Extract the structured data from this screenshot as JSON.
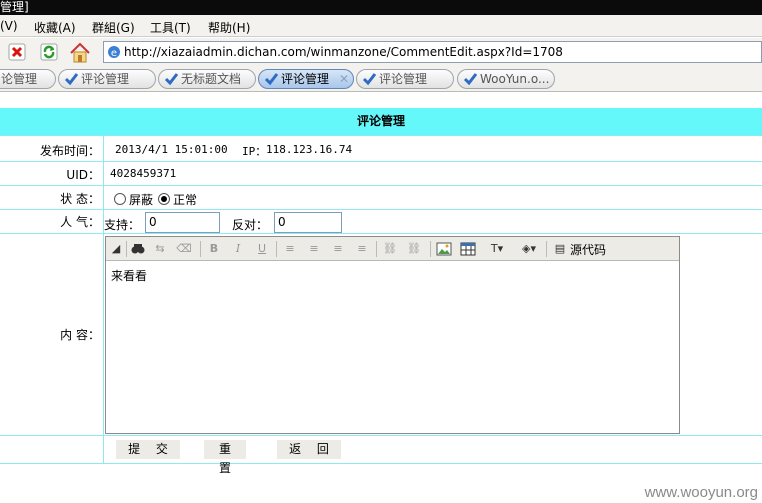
{
  "window": {
    "title": "管理]"
  },
  "menu": [
    {
      "label": "(V)"
    },
    {
      "label": "收藏(A)"
    },
    {
      "label": "群組(G)"
    },
    {
      "label": "工具(T)"
    },
    {
      "label": "帮助(H)"
    }
  ],
  "address": {
    "url": "http://xiazaiadmin.dichan.com/winmanzone/CommentEdit.aspx?Id=1708"
  },
  "tabs": [
    {
      "label": "论管理",
      "active": false
    },
    {
      "label": "评论管理",
      "active": false
    },
    {
      "label": "无标题文档",
      "active": false
    },
    {
      "label": "评论管理",
      "active": true
    },
    {
      "label": "评论管理",
      "active": false
    },
    {
      "label": "WooYun.o...",
      "active": false
    }
  ],
  "form": {
    "title": "评论管理",
    "publish_time_label": "发布时间：",
    "publish_time": "2013/4/1 15:01:00",
    "ip_label": "IP：",
    "ip": "118.123.16.74",
    "uid_label": "UID：",
    "uid": "4028459371",
    "status_label": "状 态：",
    "status_options": [
      "屏蔽",
      "正常"
    ],
    "status_selected": "正常",
    "popularity_label": "人 气：",
    "support_label": "支持：",
    "support_value": "0",
    "oppose_label": "反对：",
    "oppose_value": "0",
    "content_label": "内 容：",
    "content_text": "来看看",
    "source_code_label": "源代码",
    "submit_label": "提 交",
    "reset_label": "重 置",
    "back_label": "返 回"
  },
  "watermark": "www.wooyun.org"
}
